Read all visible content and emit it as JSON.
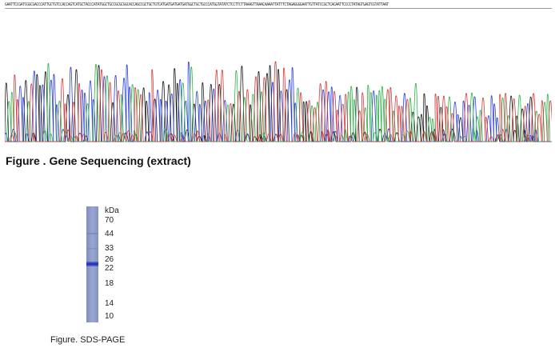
{
  "sequence": {
    "bases": "GAATTCCGATCGGCGACCCATTGCTGTCCACCAGTCATGCTACCCATATGGCTGCCGCGCGGCACCAGCCGCTGCTGTCATGATGATGATGATGGCTGCTGCCCATGGTATATCTCCTTCTTAAAGTTAAACAAAATTATTTCTAGAGGGGAATTGTTATCCGCTCACAATTCCCCTATAGTGAGTCGTATTAAT",
    "trace_colors": {
      "A": "#2db34a",
      "C": "#2a3fd6",
      "G": "#1a1a1a",
      "T": "#d63a3a"
    }
  },
  "figure1": {
    "caption": "Figure . Gene Sequencing (extract)"
  },
  "figure2": {
    "caption": "Figure. SDS-PAGE",
    "unit_label": "kDa",
    "markers": [
      {
        "kda": "70"
      },
      {
        "kda": "44"
      },
      {
        "kda": "33"
      },
      {
        "kda": "26"
      },
      {
        "kda": "22"
      },
      {
        "kda": "18"
      },
      {
        "kda": "14"
      },
      {
        "kda": "10"
      }
    ],
    "gel_color": "#8f9cc8",
    "band_color": "#1e2fb0"
  }
}
